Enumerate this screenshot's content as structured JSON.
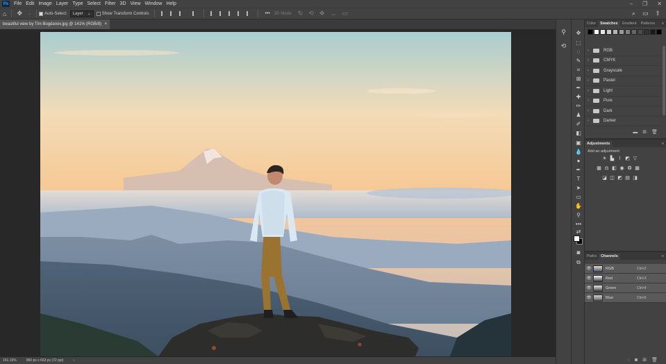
{
  "menubar": {
    "logo": "Ps",
    "items": [
      "File",
      "Edit",
      "Image",
      "Layer",
      "Type",
      "Select",
      "Filter",
      "3D",
      "View",
      "Window",
      "Help"
    ],
    "window_controls": [
      "–",
      "❐",
      "✕"
    ]
  },
  "options": {
    "auto_select_label": "Auto-Select:",
    "auto_select_value": "Layer",
    "transform_label": "Show Transform Controls",
    "more": "•••",
    "mode_3d": "3D Mode:"
  },
  "document": {
    "tab_title": "beautiful view by Tim Bogdanov.jpg @ 141% (RGB/8)",
    "close": "×"
  },
  "status": {
    "zoom": "141.15%",
    "doc_size": "960 px x 663 px (72 ppi)",
    "arrow": "›"
  },
  "swatches_panel": {
    "tabs": [
      "Color",
      "Swatches",
      "Gradient",
      "Patterns"
    ],
    "active_tab": "Swatches",
    "colors": [
      "#000000",
      "#ffffff",
      "#e6e6e6",
      "#cccccc",
      "#b3b3b3",
      "#999999",
      "#808080",
      "#666666",
      "#4d4d4d",
      "#333333",
      "#1a1a1a",
      "#000000"
    ],
    "folders": [
      "RGB",
      "CMYK",
      "Grayscale",
      "Pastel",
      "Light",
      "Pure",
      "Dark",
      "Darker"
    ]
  },
  "adjustments_panel": {
    "title": "Adjustments",
    "subtitle": "Add an adjustment"
  },
  "channels_panel": {
    "tabs": [
      "Paths",
      "Channels"
    ],
    "active_tab": "Channels",
    "channels": [
      {
        "name": "RGB",
        "shortcut": "Ctrl+2"
      },
      {
        "name": "Red",
        "shortcut": "Ctrl+3"
      },
      {
        "name": "Green",
        "shortcut": "Ctrl+4"
      },
      {
        "name": "Blue",
        "shortcut": "Ctrl+5"
      }
    ]
  }
}
